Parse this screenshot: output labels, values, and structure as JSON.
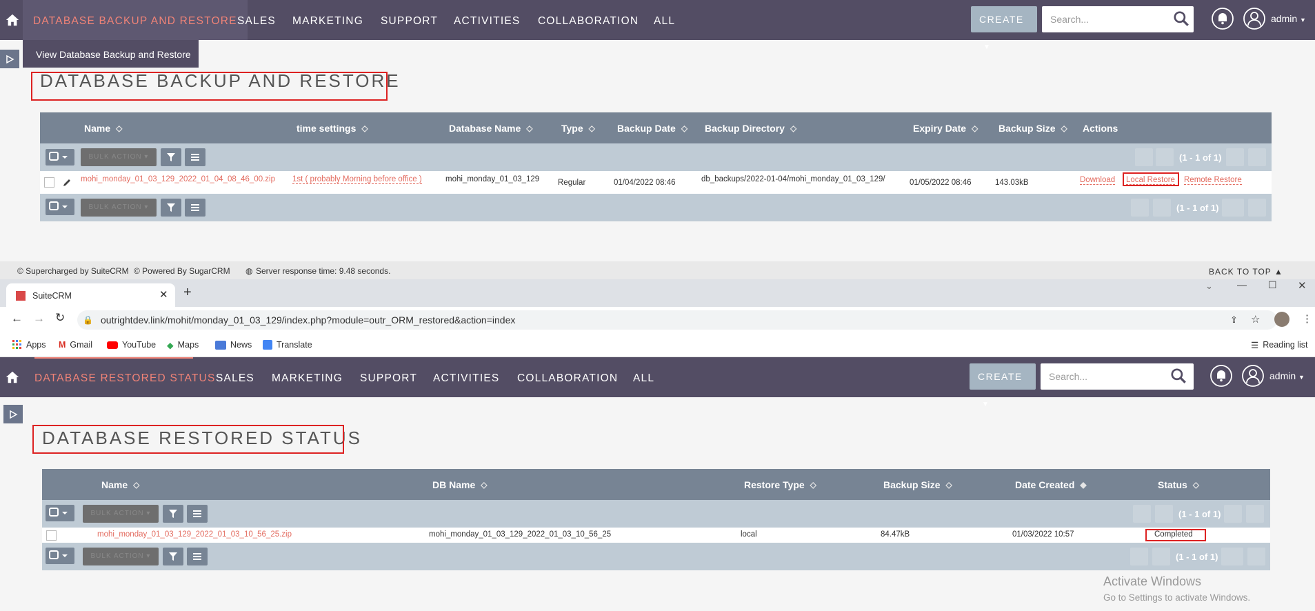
{
  "top": {
    "nav": {
      "active": "DATABASE BACKUP AND RESTORE",
      "items": [
        "SALES",
        "MARKETING",
        "SUPPORT",
        "ACTIVITIES",
        "COLLABORATION",
        "ALL"
      ],
      "create": "CREATE",
      "search_placeholder": "Search...",
      "user": "admin"
    },
    "submenu": "View Database Backup and Restore",
    "title": "DATABASE BACKUP AND RESTORE",
    "columns": [
      "Name",
      "time settings",
      "Database Name",
      "Type",
      "Backup Date",
      "Backup Directory",
      "Expiry Date",
      "Backup Size",
      "Actions"
    ],
    "bulk_action": "BULK ACTION",
    "pagination": "(1 - 1 of 1)",
    "row": {
      "name": "mohi_monday_01_03_129_2022_01_04_08_46_00.zip",
      "time_settings": "1st ( probably Morning before office )",
      "database_name": "mohi_monday_01_03_129",
      "type": "Regular",
      "backup_date": "01/04/2022 08:46",
      "backup_directory": "db_backups/2022-01-04/mohi_monday_01_03_129/",
      "expiry_date": "01/05/2022 08:46",
      "backup_size": "143.03kB",
      "action_download": "Download",
      "action_local": "Local Restore",
      "action_remote": "Remote Restore"
    },
    "footer": {
      "supercharged": "© Supercharged by SuiteCRM",
      "powered": "© Powered By SugarCRM",
      "response": "Server response time: 9.48 seconds.",
      "back_to_top": "BACK TO TOP"
    }
  },
  "browser": {
    "tab_title": "SuiteCRM",
    "url": "outrightdev.link/mohit/monday_01_03_129/index.php?module=outr_ORM_restored&action=index",
    "bookmarks": [
      "Apps",
      "Gmail",
      "YouTube",
      "Maps",
      "News",
      "Translate"
    ],
    "reading_list": "Reading list"
  },
  "bottom": {
    "nav": {
      "active": "DATABASE RESTORED STATUS",
      "items": [
        "SALES",
        "MARKETING",
        "SUPPORT",
        "ACTIVITIES",
        "COLLABORATION",
        "ALL"
      ],
      "create": "CREATE",
      "search_placeholder": "Search...",
      "user": "admin"
    },
    "title": "DATABASE RESTORED STATUS",
    "columns": [
      "Name",
      "DB Name",
      "Restore Type",
      "Backup Size",
      "Date Created",
      "Status"
    ],
    "bulk_action": "BULK ACTION",
    "pagination": "(1 - 1 of 1)",
    "row": {
      "name": "mohi_monday_01_03_129_2022_01_03_10_56_25.zip",
      "db_name": "mohi_monday_01_03_129_2022_01_03_10_56_25",
      "restore_type": "local",
      "backup_size": "84.47kB",
      "date_created": "01/03/2022 10:57",
      "status": "Completed"
    }
  },
  "watermark": {
    "title": "Activate Windows",
    "subtitle": "Go to Settings to activate Windows."
  }
}
